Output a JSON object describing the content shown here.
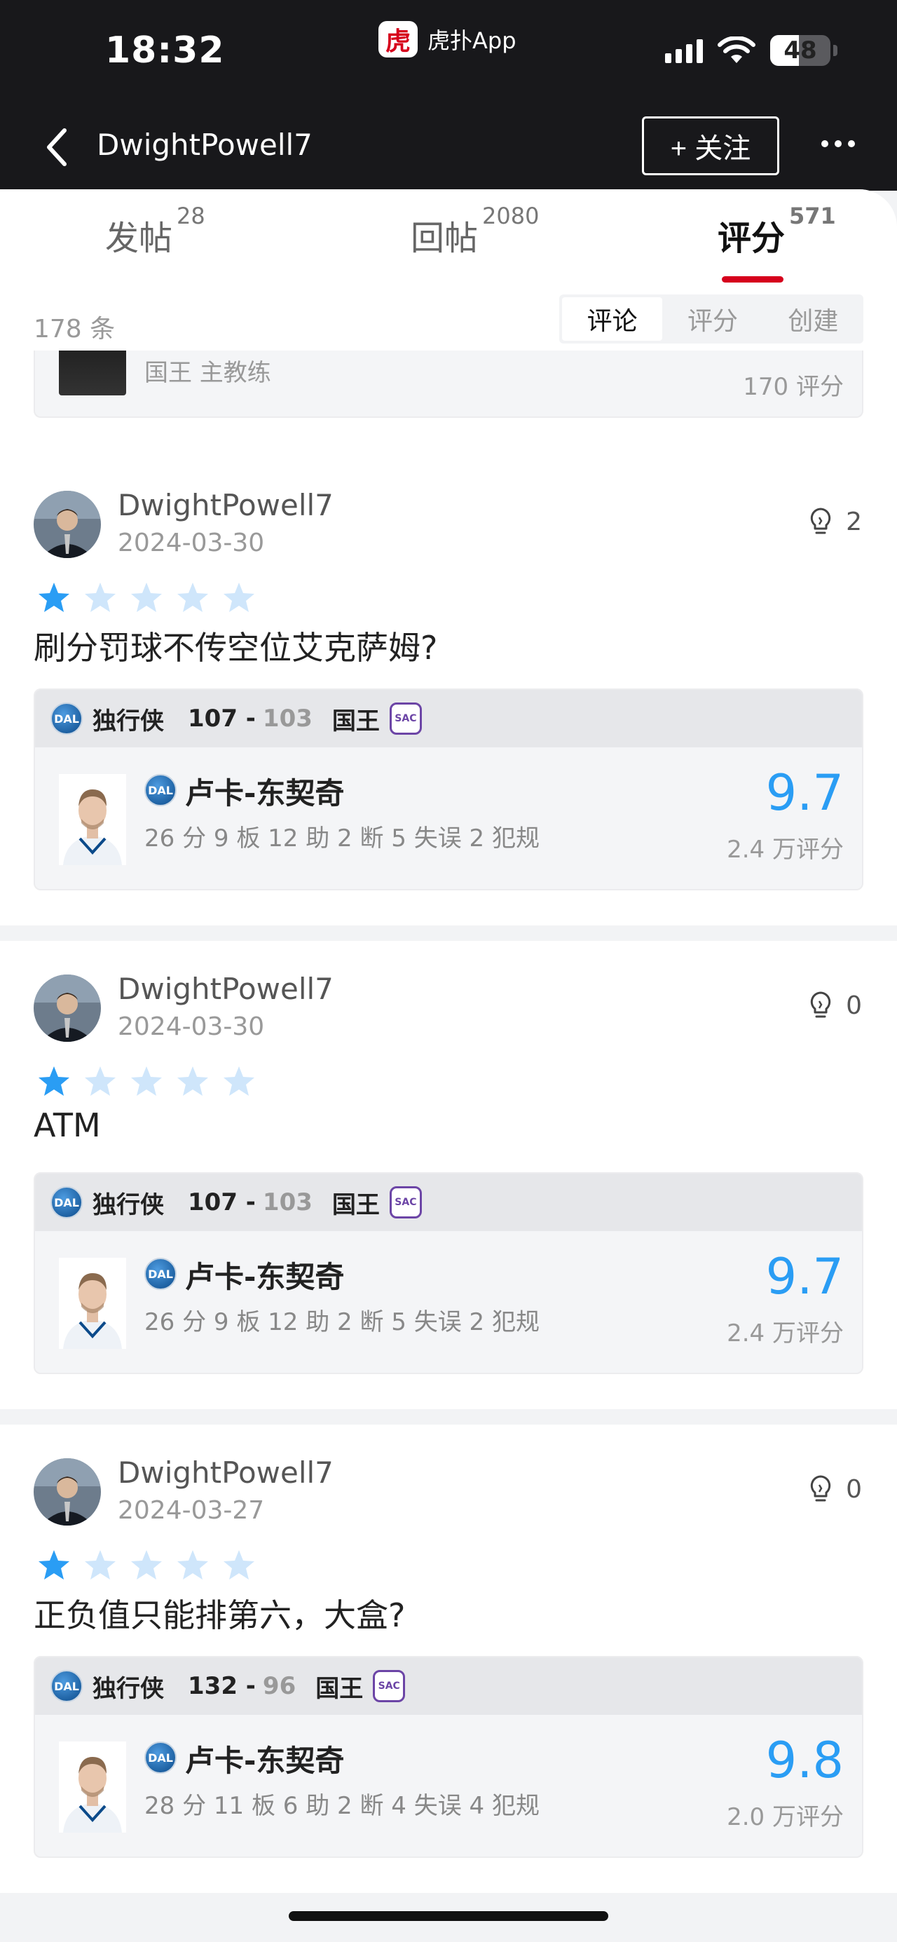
{
  "status_bar": {
    "time": "18:32",
    "app_name": "虎扑App",
    "app_logo_text": "虎",
    "battery": "48",
    "battery_level": 0.48
  },
  "nav": {
    "title": "DwightPowell7",
    "follow_label": "+ 关注"
  },
  "tabs": [
    {
      "label": "发帖",
      "count": "28"
    },
    {
      "label": "回帖",
      "count": "2080"
    },
    {
      "label": "评分",
      "count": "571",
      "active": true
    }
  ],
  "filter": {
    "count": "178 条",
    "segments": [
      "评论",
      "评分",
      "创建"
    ],
    "active_segment": "评论"
  },
  "partial_card": {
    "role": "国王 主教练",
    "ratings": "170 评分"
  },
  "reviews": [
    {
      "username": "DwightPowell7",
      "date": "2024-03-30",
      "likes": "2",
      "stars": 1,
      "comment": "刷分罚球不传空位艾克萨姆?",
      "game": {
        "away_team": "独行侠",
        "away_score": "107 -",
        "home_score": "103",
        "home_team": "国王",
        "away_logo": "DAL",
        "home_logo": "SAC"
      },
      "player": {
        "name": "卢卡-东契奇",
        "stats": "26 分 9 板 12 助 2 断 5 失误 2 犯规",
        "score": "9.7",
        "rating_count": "2.4 万评分",
        "team_logo": "DAL"
      }
    },
    {
      "username": "DwightPowell7",
      "date": "2024-03-30",
      "likes": "0",
      "stars": 1,
      "comment": "ATM",
      "game": {
        "away_team": "独行侠",
        "away_score": "107 -",
        "home_score": "103",
        "home_team": "国王",
        "away_logo": "DAL",
        "home_logo": "SAC"
      },
      "player": {
        "name": "卢卡-东契奇",
        "stats": "26 分 9 板 12 助 2 断 5 失误 2 犯规",
        "score": "9.7",
        "rating_count": "2.4 万评分",
        "team_logo": "DAL"
      }
    },
    {
      "username": "DwightPowell7",
      "date": "2024-03-27",
      "likes": "0",
      "stars": 1,
      "comment": "正负值只能排第六，大盒?",
      "game": {
        "away_team": "独行侠",
        "away_score": "132 -",
        "home_score": "96",
        "home_team": "国王",
        "away_logo": "DAL",
        "home_logo": "SAC"
      },
      "player": {
        "name": "卢卡-东契奇",
        "stats": "28 分 11 板 6 助 2 断 4 失误 4 犯规",
        "score": "9.8",
        "rating_count": "2.0 万评分",
        "team_logo": "DAL"
      }
    }
  ],
  "colors": {
    "accent": "#d6001c",
    "score_blue": "#2a9df4",
    "star_filled": "#2a9df4",
    "star_empty": "#cfe6fb"
  }
}
